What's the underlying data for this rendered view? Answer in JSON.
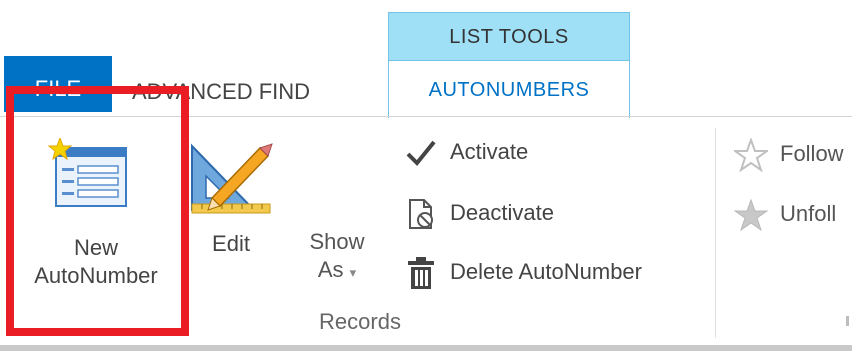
{
  "tabs": {
    "file": "FILE",
    "advanced_find": "ADVANCED FIND",
    "contextual_group": "LIST TOOLS",
    "contextual_tab": "AUTONUMBERS"
  },
  "ribbon": {
    "new_autonumber": {
      "line1": "New",
      "line2": "AutoNumber",
      "icon": "new-form-icon"
    },
    "edit": {
      "label": "Edit",
      "icon": "edit-ruler-pencil-icon"
    },
    "show_as": {
      "line1": "Show",
      "line2": "As",
      "caret": "▾"
    },
    "activate": {
      "label": "Activate",
      "icon": "checkmark-icon"
    },
    "deactivate": {
      "label": "Deactivate",
      "icon": "deactivate-icon"
    },
    "delete_autonumber": {
      "label": "Delete AutoNumber",
      "icon": "trash-icon"
    },
    "group_label": "Records",
    "follow": {
      "label": "Follow",
      "icon": "star-outline-icon"
    },
    "unfollow": {
      "label": "Unfoll",
      "icon": "star-filled-icon"
    }
  },
  "colors": {
    "file_tab": "#0072c6",
    "contextual_header": "#9fe0f7",
    "contextual_tab_text": "#0072c6",
    "highlight": "#ea1c24"
  }
}
